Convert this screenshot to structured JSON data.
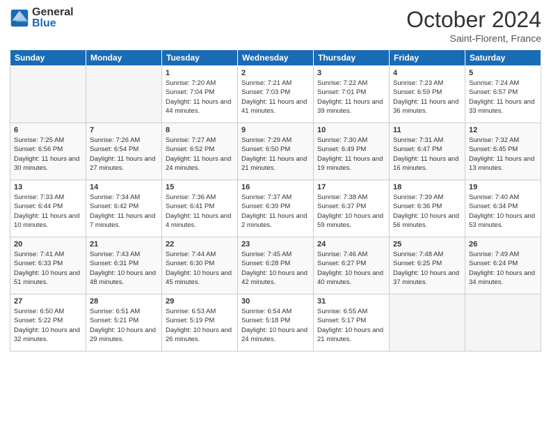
{
  "logo": {
    "general": "General",
    "blue": "Blue"
  },
  "title": "October 2024",
  "location": "Saint-Florent, France",
  "headers": [
    "Sunday",
    "Monday",
    "Tuesday",
    "Wednesday",
    "Thursday",
    "Friday",
    "Saturday"
  ],
  "weeks": [
    [
      {
        "day": "",
        "sunrise": "",
        "sunset": "",
        "daylight": ""
      },
      {
        "day": "",
        "sunrise": "",
        "sunset": "",
        "daylight": ""
      },
      {
        "day": "1",
        "sunrise": "Sunrise: 7:20 AM",
        "sunset": "Sunset: 7:04 PM",
        "daylight": "Daylight: 11 hours and 44 minutes."
      },
      {
        "day": "2",
        "sunrise": "Sunrise: 7:21 AM",
        "sunset": "Sunset: 7:03 PM",
        "daylight": "Daylight: 11 hours and 41 minutes."
      },
      {
        "day": "3",
        "sunrise": "Sunrise: 7:22 AM",
        "sunset": "Sunset: 7:01 PM",
        "daylight": "Daylight: 11 hours and 39 minutes."
      },
      {
        "day": "4",
        "sunrise": "Sunrise: 7:23 AM",
        "sunset": "Sunset: 6:59 PM",
        "daylight": "Daylight: 11 hours and 36 minutes."
      },
      {
        "day": "5",
        "sunrise": "Sunrise: 7:24 AM",
        "sunset": "Sunset: 6:57 PM",
        "daylight": "Daylight: 11 hours and 33 minutes."
      }
    ],
    [
      {
        "day": "6",
        "sunrise": "Sunrise: 7:25 AM",
        "sunset": "Sunset: 6:56 PM",
        "daylight": "Daylight: 11 hours and 30 minutes."
      },
      {
        "day": "7",
        "sunrise": "Sunrise: 7:26 AM",
        "sunset": "Sunset: 6:54 PM",
        "daylight": "Daylight: 11 hours and 27 minutes."
      },
      {
        "day": "8",
        "sunrise": "Sunrise: 7:27 AM",
        "sunset": "Sunset: 6:52 PM",
        "daylight": "Daylight: 11 hours and 24 minutes."
      },
      {
        "day": "9",
        "sunrise": "Sunrise: 7:29 AM",
        "sunset": "Sunset: 6:50 PM",
        "daylight": "Daylight: 11 hours and 21 minutes."
      },
      {
        "day": "10",
        "sunrise": "Sunrise: 7:30 AM",
        "sunset": "Sunset: 6:49 PM",
        "daylight": "Daylight: 11 hours and 19 minutes."
      },
      {
        "day": "11",
        "sunrise": "Sunrise: 7:31 AM",
        "sunset": "Sunset: 6:47 PM",
        "daylight": "Daylight: 11 hours and 16 minutes."
      },
      {
        "day": "12",
        "sunrise": "Sunrise: 7:32 AM",
        "sunset": "Sunset: 6:45 PM",
        "daylight": "Daylight: 11 hours and 13 minutes."
      }
    ],
    [
      {
        "day": "13",
        "sunrise": "Sunrise: 7:33 AM",
        "sunset": "Sunset: 6:44 PM",
        "daylight": "Daylight: 11 hours and 10 minutes."
      },
      {
        "day": "14",
        "sunrise": "Sunrise: 7:34 AM",
        "sunset": "Sunset: 6:42 PM",
        "daylight": "Daylight: 11 hours and 7 minutes."
      },
      {
        "day": "15",
        "sunrise": "Sunrise: 7:36 AM",
        "sunset": "Sunset: 6:41 PM",
        "daylight": "Daylight: 11 hours and 4 minutes."
      },
      {
        "day": "16",
        "sunrise": "Sunrise: 7:37 AM",
        "sunset": "Sunset: 6:39 PM",
        "daylight": "Daylight: 11 hours and 2 minutes."
      },
      {
        "day": "17",
        "sunrise": "Sunrise: 7:38 AM",
        "sunset": "Sunset: 6:37 PM",
        "daylight": "Daylight: 10 hours and 59 minutes."
      },
      {
        "day": "18",
        "sunrise": "Sunrise: 7:39 AM",
        "sunset": "Sunset: 6:36 PM",
        "daylight": "Daylight: 10 hours and 56 minutes."
      },
      {
        "day": "19",
        "sunrise": "Sunrise: 7:40 AM",
        "sunset": "Sunset: 6:34 PM",
        "daylight": "Daylight: 10 hours and 53 minutes."
      }
    ],
    [
      {
        "day": "20",
        "sunrise": "Sunrise: 7:41 AM",
        "sunset": "Sunset: 6:33 PM",
        "daylight": "Daylight: 10 hours and 51 minutes."
      },
      {
        "day": "21",
        "sunrise": "Sunrise: 7:43 AM",
        "sunset": "Sunset: 6:31 PM",
        "daylight": "Daylight: 10 hours and 48 minutes."
      },
      {
        "day": "22",
        "sunrise": "Sunrise: 7:44 AM",
        "sunset": "Sunset: 6:30 PM",
        "daylight": "Daylight: 10 hours and 45 minutes."
      },
      {
        "day": "23",
        "sunrise": "Sunrise: 7:45 AM",
        "sunset": "Sunset: 6:28 PM",
        "daylight": "Daylight: 10 hours and 42 minutes."
      },
      {
        "day": "24",
        "sunrise": "Sunrise: 7:46 AM",
        "sunset": "Sunset: 6:27 PM",
        "daylight": "Daylight: 10 hours and 40 minutes."
      },
      {
        "day": "25",
        "sunrise": "Sunrise: 7:48 AM",
        "sunset": "Sunset: 6:25 PM",
        "daylight": "Daylight: 10 hours and 37 minutes."
      },
      {
        "day": "26",
        "sunrise": "Sunrise: 7:49 AM",
        "sunset": "Sunset: 6:24 PM",
        "daylight": "Daylight: 10 hours and 34 minutes."
      }
    ],
    [
      {
        "day": "27",
        "sunrise": "Sunrise: 6:50 AM",
        "sunset": "Sunset: 5:22 PM",
        "daylight": "Daylight: 10 hours and 32 minutes."
      },
      {
        "day": "28",
        "sunrise": "Sunrise: 6:51 AM",
        "sunset": "Sunset: 5:21 PM",
        "daylight": "Daylight: 10 hours and 29 minutes."
      },
      {
        "day": "29",
        "sunrise": "Sunrise: 6:53 AM",
        "sunset": "Sunset: 5:19 PM",
        "daylight": "Daylight: 10 hours and 26 minutes."
      },
      {
        "day": "30",
        "sunrise": "Sunrise: 6:54 AM",
        "sunset": "Sunset: 5:18 PM",
        "daylight": "Daylight: 10 hours and 24 minutes."
      },
      {
        "day": "31",
        "sunrise": "Sunrise: 6:55 AM",
        "sunset": "Sunset: 5:17 PM",
        "daylight": "Daylight: 10 hours and 21 minutes."
      },
      {
        "day": "",
        "sunrise": "",
        "sunset": "",
        "daylight": ""
      },
      {
        "day": "",
        "sunrise": "",
        "sunset": "",
        "daylight": ""
      }
    ]
  ]
}
